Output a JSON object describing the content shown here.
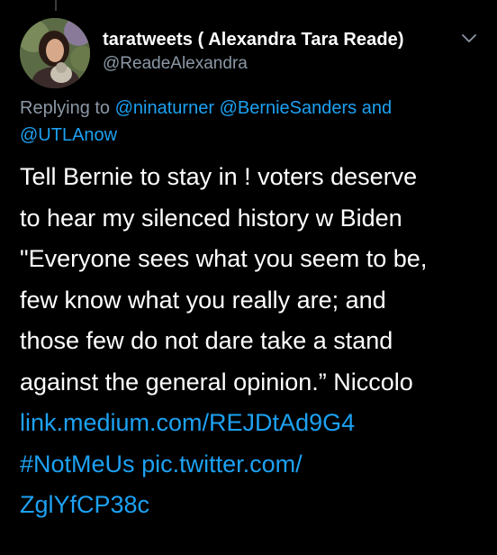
{
  "author": {
    "display_name": "taratweets ( Alexandra Tara Reade)",
    "handle": "@ReadeAlexandra"
  },
  "reply": {
    "prefix": "Replying to",
    "mentions": [
      "@ninaturner",
      "@BernieSanders"
    ],
    "conjunction": "and",
    "last_mention": "@UTLAnow"
  },
  "tweet": {
    "lines": [
      "Tell Bernie to stay in ! voters deserve",
      "to hear my silenced history w Biden",
      "\"Everyone sees what you seem to be,",
      "few know what you really are; and",
      "those few do not dare take a stand",
      "against the general opinion.” Niccolo"
    ],
    "link": "link.medium.com/REJDtAd9G4",
    "hashtag": "#NotMeUs",
    "pic_link_part1": "pic.twitter.com/",
    "pic_link_part2": "ZglYfCP38c"
  },
  "colors": {
    "background": "#000000",
    "text": "#ffffff",
    "secondary": "#8b98a5",
    "accent": "#1da1f2"
  },
  "icons": {
    "menu": "chevron-down-icon",
    "avatar": "profile-photo"
  }
}
